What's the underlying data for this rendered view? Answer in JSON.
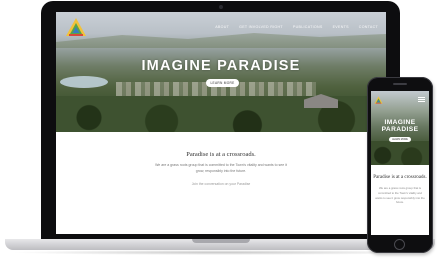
{
  "site": {
    "brand_colors": {
      "logo_yellow": "#f2c23a",
      "logo_green": "#59a34a",
      "logo_blue": "#3a7cc4",
      "logo_red": "#d9483b"
    },
    "nav": [
      "About",
      "Get Involved Right",
      "Publications",
      "Events",
      "Contact"
    ],
    "hero": {
      "title": "IMAGINE PARADISE",
      "button_label": "LEARN MORE"
    },
    "content": {
      "heading": "Paradise is at a crossroads.",
      "body": "We are a grass roots group that is committed to the Town's vitality and wants to see it grow, responsibly into the future.",
      "link": "Join the conversation on your Paradise"
    }
  },
  "mobile": {
    "hero": {
      "title": "IMAGINE PARADISE",
      "button_label": "LEARN MORE"
    },
    "content": {
      "heading": "Paradise is at a crossroads.",
      "body": "We are a grass roots group that is committed to the Town's vitality and wants to see it grow responsibly into the future."
    },
    "menu_icon": "hamburger-icon"
  }
}
